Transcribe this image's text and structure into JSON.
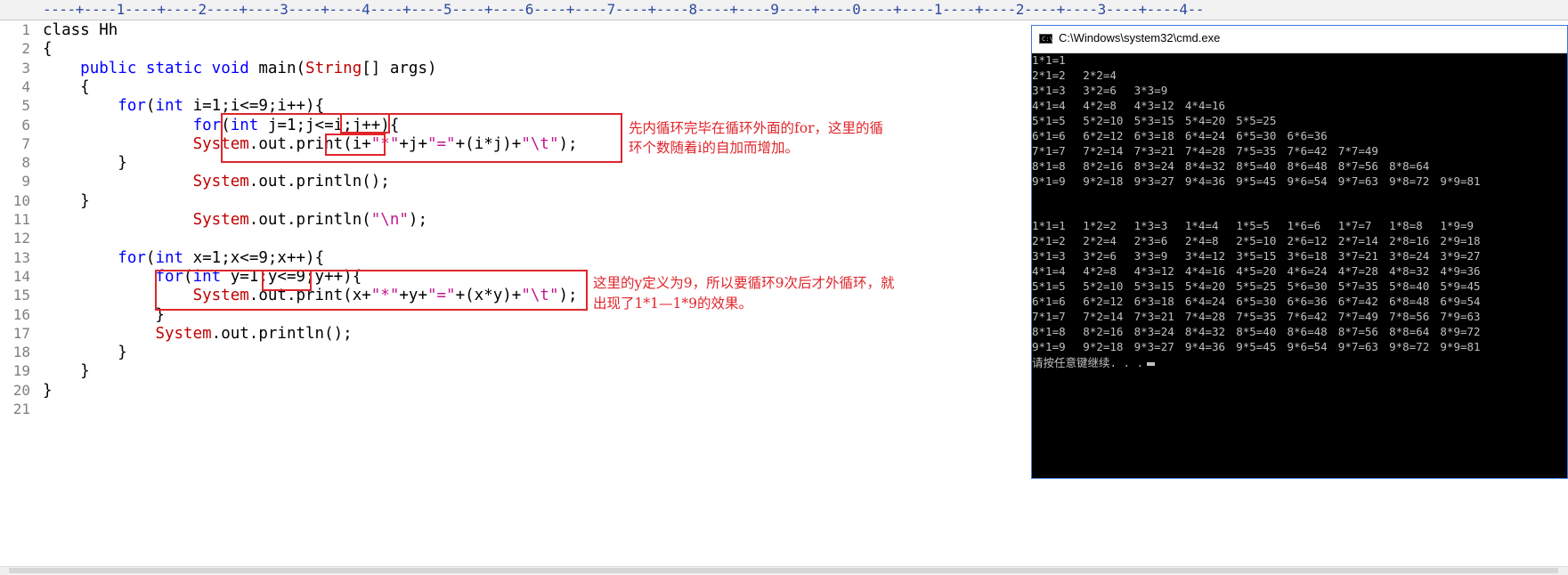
{
  "ruler": "----+----1----+----2----+----3----+----4----+----5----+----6----+----7----+----8----+----9----+----0----+----1----+----2----+----3----+----4--",
  "line_numbers": [
    "1",
    "2",
    "3",
    "4",
    "5",
    "6",
    "7",
    "8",
    "9",
    "10",
    "11",
    "12",
    "13",
    "14",
    "15",
    "16",
    "17",
    "18",
    "19",
    "20",
    "21"
  ],
  "code": {
    "l1": [
      "class Hh"
    ],
    "l2": [
      "{"
    ],
    "l3": [
      "    ",
      "public static void",
      " main(",
      "String",
      "[] args)"
    ],
    "l4": [
      "    {"
    ],
    "l5": [
      "        ",
      "for",
      "(",
      "int",
      " i=1;i<=9;i++){"
    ],
    "l6": [
      "                ",
      "for",
      "(",
      "int",
      " j=1;j<=i;j++){"
    ],
    "l7": [
      "                ",
      "System",
      ".out.print(i+",
      "\"*\"",
      "+j+",
      "\"=\"",
      "+(i*j)+",
      "\"\\t\"",
      ");"
    ],
    "l8": [
      "        }"
    ],
    "l9": [
      "                ",
      "System",
      ".out.println();"
    ],
    "l10": [
      "    }"
    ],
    "l11": [
      "                ",
      "System",
      ".out.println(",
      "\"\\n\"",
      ");"
    ],
    "l12": [
      ""
    ],
    "l13": [
      "        ",
      "for",
      "(",
      "int",
      " x=1;x<=9;x++){"
    ],
    "l14": [
      "            ",
      "for",
      "(",
      "int",
      " y=1;y<=9;y++){"
    ],
    "l15": [
      "                ",
      "System",
      ".out.print(x+",
      "\"*\"",
      "+y+",
      "\"=\"",
      "+(x*y)+",
      "\"\\t\"",
      ");"
    ],
    "l16": [
      "            }"
    ],
    "l17": [
      "            ",
      "System",
      ".out.println();"
    ],
    "l18": [
      "        }"
    ],
    "l19": [
      "    }"
    ],
    "l20": [
      "}"
    ],
    "l21": [
      ""
    ]
  },
  "annotations": {
    "note1_line1": "先内循环完毕在循环外面的for，这里的循",
    "note1_line2": "环个数随着i的自加而增加。",
    "note2_line1": "这里的y定义为9，所以要循环9次后才外循环，就",
    "note2_line2": "出现了1*1—1*9的效果。"
  },
  "cmd": {
    "title": "C:\\Windows\\system32\\cmd.exe",
    "icon": "cmd-icon",
    "block1": [
      [
        "1*1=1"
      ],
      [
        "2*1=2",
        "2*2=4"
      ],
      [
        "3*1=3",
        "3*2=6",
        "3*3=9"
      ],
      [
        "4*1=4",
        "4*2=8",
        "4*3=12",
        "4*4=16"
      ],
      [
        "5*1=5",
        "5*2=10",
        "5*3=15",
        "5*4=20",
        "5*5=25"
      ],
      [
        "6*1=6",
        "6*2=12",
        "6*3=18",
        "6*4=24",
        "6*5=30",
        "6*6=36"
      ],
      [
        "7*1=7",
        "7*2=14",
        "7*3=21",
        "7*4=28",
        "7*5=35",
        "7*6=42",
        "7*7=49"
      ],
      [
        "8*1=8",
        "8*2=16",
        "8*3=24",
        "8*4=32",
        "8*5=40",
        "8*6=48",
        "8*7=56",
        "8*8=64"
      ],
      [
        "9*1=9",
        "9*2=18",
        "9*3=27",
        "9*4=36",
        "9*5=45",
        "9*6=54",
        "9*7=63",
        "9*8=72",
        "9*9=81"
      ]
    ],
    "block2": [
      [
        "1*1=1",
        "1*2=2",
        "1*3=3",
        "1*4=4",
        "1*5=5",
        "1*6=6",
        "1*7=7",
        "1*8=8",
        "1*9=9"
      ],
      [
        "2*1=2",
        "2*2=4",
        "2*3=6",
        "2*4=8",
        "2*5=10",
        "2*6=12",
        "2*7=14",
        "2*8=16",
        "2*9=18"
      ],
      [
        "3*1=3",
        "3*2=6",
        "3*3=9",
        "3*4=12",
        "3*5=15",
        "3*6=18",
        "3*7=21",
        "3*8=24",
        "3*9=27"
      ],
      [
        "4*1=4",
        "4*2=8",
        "4*3=12",
        "4*4=16",
        "4*5=20",
        "4*6=24",
        "4*7=28",
        "4*8=32",
        "4*9=36"
      ],
      [
        "5*1=5",
        "5*2=10",
        "5*3=15",
        "5*4=20",
        "5*5=25",
        "5*6=30",
        "5*7=35",
        "5*8=40",
        "5*9=45"
      ],
      [
        "6*1=6",
        "6*2=12",
        "6*3=18",
        "6*4=24",
        "6*5=30",
        "6*6=36",
        "6*7=42",
        "6*8=48",
        "6*9=54"
      ],
      [
        "7*1=7",
        "7*2=14",
        "7*3=21",
        "7*4=28",
        "7*5=35",
        "7*6=42",
        "7*7=49",
        "7*8=56",
        "7*9=63"
      ],
      [
        "8*1=8",
        "8*2=16",
        "8*3=24",
        "8*4=32",
        "8*5=40",
        "8*6=48",
        "8*7=56",
        "8*8=64",
        "8*9=72"
      ],
      [
        "9*1=9",
        "9*2=18",
        "9*3=27",
        "9*4=36",
        "9*5=45",
        "9*6=54",
        "9*7=63",
        "9*8=72",
        "9*9=81"
      ]
    ],
    "prompt": "请按任意键继续. . ."
  },
  "colors": {
    "keyword": "#0000ff",
    "type": "#c00000",
    "string": "#c2178e",
    "annotation": "#e0252b",
    "line_number": "#808080",
    "console_text": "#c0c0c0"
  }
}
